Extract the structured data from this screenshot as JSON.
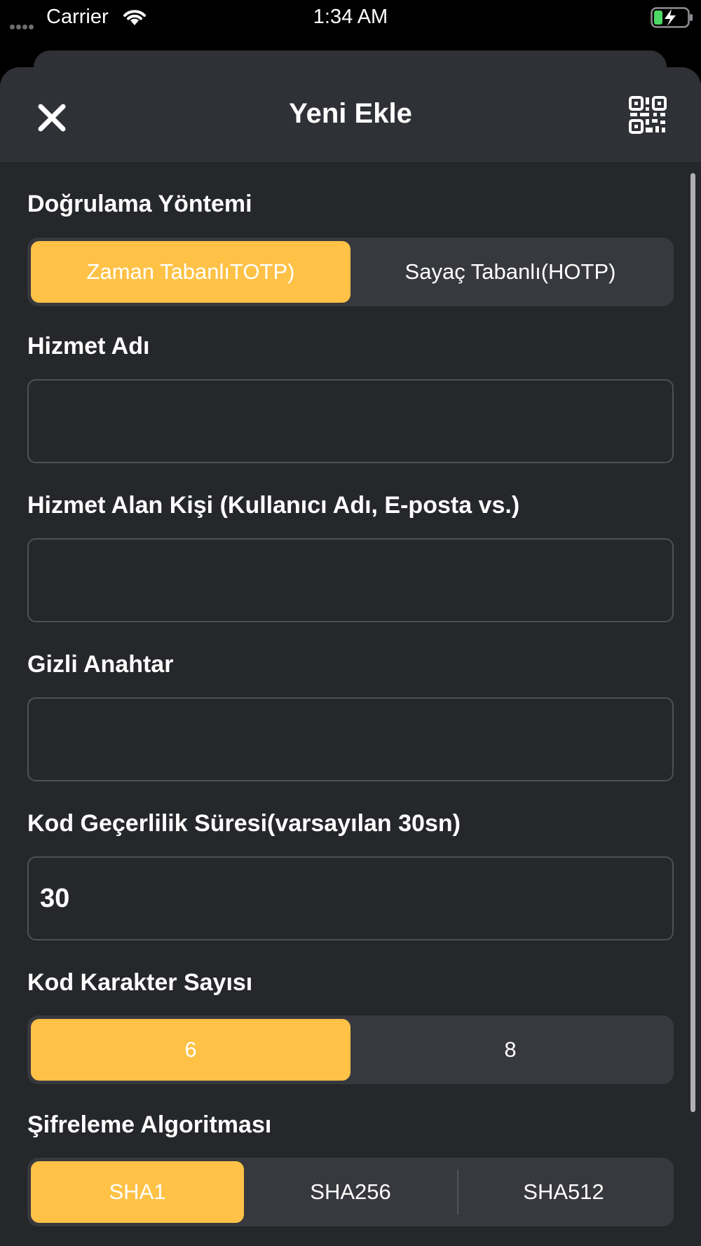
{
  "status_bar": {
    "carrier": "Carrier",
    "time": "1:34 AM"
  },
  "nav": {
    "title": "Yeni Ekle",
    "close_icon": "close-icon",
    "qr_icon": "qr-code-icon"
  },
  "auth_method": {
    "label": "Doğrulama Yöntemi",
    "options": [
      "Zaman TabanlıTOTP)",
      "Sayaç Tabanlı(HOTP)"
    ],
    "selected": "Zaman TabanlıTOTP)"
  },
  "service_name": {
    "label": "Hizmet Adı",
    "value": ""
  },
  "account_name": {
    "label": "Hizmet Alan Kişi (Kullanıcı Adı, E-posta vs.)",
    "value": ""
  },
  "secret_key": {
    "label": "Gizli Anahtar",
    "value": ""
  },
  "validity_period": {
    "label": "Kod Geçerlilik Süresi(varsayılan 30sn)",
    "value": "30"
  },
  "digits": {
    "label": "Kod Karakter Sayısı",
    "options": [
      "6",
      "8"
    ],
    "selected": "6"
  },
  "algorithm": {
    "label": "Şifreleme Algoritması",
    "options": [
      "SHA1",
      "SHA256",
      "SHA512"
    ],
    "selected": "SHA1"
  },
  "colors": {
    "accent": "#ffc247",
    "background": "#26272b",
    "header": "#2f3136"
  }
}
